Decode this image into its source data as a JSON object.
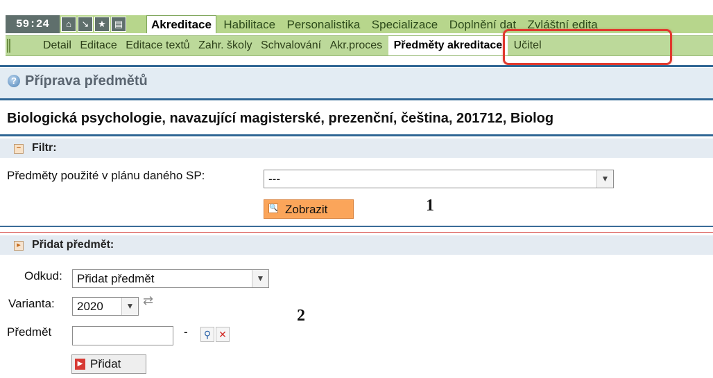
{
  "topbar": {
    "time": "59:24",
    "icons": [
      "home-icon",
      "arrow-icon",
      "star-icon",
      "print-icon"
    ],
    "tabs": [
      "Akreditace",
      "Habilitace",
      "Personalistika",
      "Specializace",
      "Doplnění dat",
      "Zvláštní edita"
    ]
  },
  "subbar": {
    "tabs": [
      "Detail",
      "Editace",
      "Editace textů",
      "Zahr. školy",
      "Schvalování",
      "Akr.proces",
      "Předměty akreditace",
      "Učitel"
    ]
  },
  "page": {
    "title": "Příprava předmětů",
    "program": "Biologická psychologie, navazující magisterské, prezenční, čeština, 201712, Biolog"
  },
  "filter": {
    "header": "Filtr:",
    "label": "Předměty použité v plánu daného SP:",
    "select_value": "---",
    "button": "Zobrazit",
    "annotation": "1"
  },
  "add": {
    "header": "Přidat předmět:",
    "from_label": "Odkud:",
    "from_value": "Přidat předmět",
    "variant_label": "Varianta:",
    "variant_value": "2020",
    "subject_label": "Předmět",
    "subject_value": "",
    "dash": "-",
    "button": "Přidat",
    "annotation": "2"
  },
  "colors": {
    "tab_bar": "#b7d68c",
    "sub_bar": "#bcd99a",
    "header_line": "#2f6694",
    "section_bg": "#e4ebf2",
    "highlight": "#e0392e",
    "button_orange": "#fba55a"
  }
}
